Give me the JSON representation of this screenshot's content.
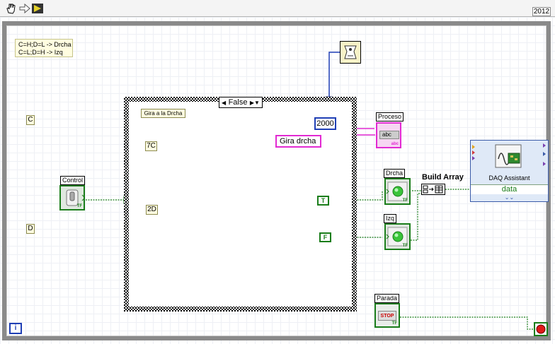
{
  "toolbar": {
    "items": [
      {
        "name": "operate-value-icon"
      },
      {
        "name": "arrow-right-icon"
      },
      {
        "name": "run-icon"
      }
    ],
    "version": "2012"
  },
  "comment": "C=H;D=L -> Drcha\nC=L;D=H -> Izq",
  "consts": {
    "c": "C",
    "d": "D",
    "seven_c": "7C",
    "two_d": "2D"
  },
  "case_structure": {
    "selector_value": "False",
    "label": "Gira a la Drcha"
  },
  "wait_const": "2000",
  "string_const": "Gira drcha",
  "labels": {
    "control": "Control",
    "proceso": "Proceso",
    "drcha": "Drcha",
    "izq": "Izq",
    "parada": "Parada",
    "build_array": "Build Array"
  },
  "proceso_indicator": "abc",
  "bool_consts": {
    "t": "T",
    "f": "F"
  },
  "tf_mark": "TF",
  "daq": {
    "title": "DAQ Assistant",
    "output": "data"
  },
  "stop_label": "STOP",
  "info_label": "i",
  "colors": {
    "numeric_wire": "#1f3fb5",
    "string_wire": "#e22ad2",
    "boolean_wire": "#1a7d1a"
  }
}
